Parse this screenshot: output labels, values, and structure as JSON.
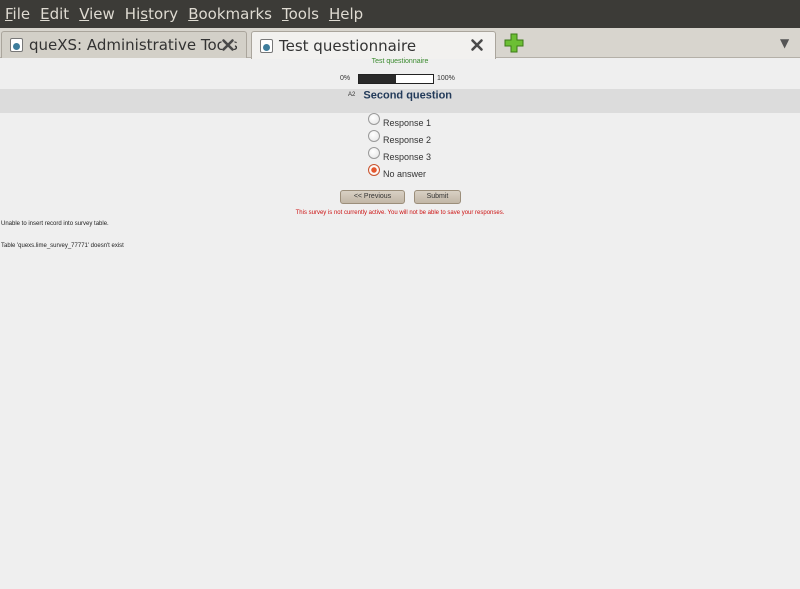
{
  "menubar": {
    "items": [
      {
        "label": "File",
        "mnemonic_index": 0
      },
      {
        "label": "Edit",
        "mnemonic_index": 0
      },
      {
        "label": "View",
        "mnemonic_index": 0
      },
      {
        "label": "History",
        "mnemonic_index": 2
      },
      {
        "label": "Bookmarks",
        "mnemonic_index": 0
      },
      {
        "label": "Tools",
        "mnemonic_index": 0
      },
      {
        "label": "Help",
        "mnemonic_index": 0
      }
    ]
  },
  "tabs": [
    {
      "title": "queXS: Administrative Tools",
      "active": false,
      "icon": "page-favicon",
      "close_icon": "close-icon"
    },
    {
      "title": "Test questionnaire",
      "active": true,
      "icon": "page-favicon",
      "close_icon": "close-icon"
    }
  ],
  "new_tab_icon": "plus-icon",
  "tab_list_icon": "chevron-down-icon",
  "tab_list_glyph": "▼",
  "survey": {
    "title": "Test questionnaire",
    "progress": {
      "min_label": "0%",
      "max_label": "100%",
      "value_percent": 50
    },
    "question": {
      "number": "A2",
      "text": "Second question"
    },
    "answers": [
      {
        "label": "Response 1",
        "checked": false
      },
      {
        "label": "Response 2",
        "checked": false
      },
      {
        "label": "Response 3",
        "checked": false
      },
      {
        "label": "No answer",
        "checked": true
      }
    ],
    "buttons": {
      "previous": "<< Previous",
      "submit": "Submit"
    },
    "warning": "This survey is not currently active. You will not be able to save your responses.",
    "errors": [
      "Unable to insert record into survey table.",
      "Table 'quexs.lime_survey_77771' doesn't exist"
    ]
  },
  "colors": {
    "menubar_bg": "#3c3b37",
    "survey_title": "#3a8a2e",
    "warning": "#cc1111",
    "radio_selected": "#e4572e",
    "new_tab_plus": "#5fae2d"
  }
}
